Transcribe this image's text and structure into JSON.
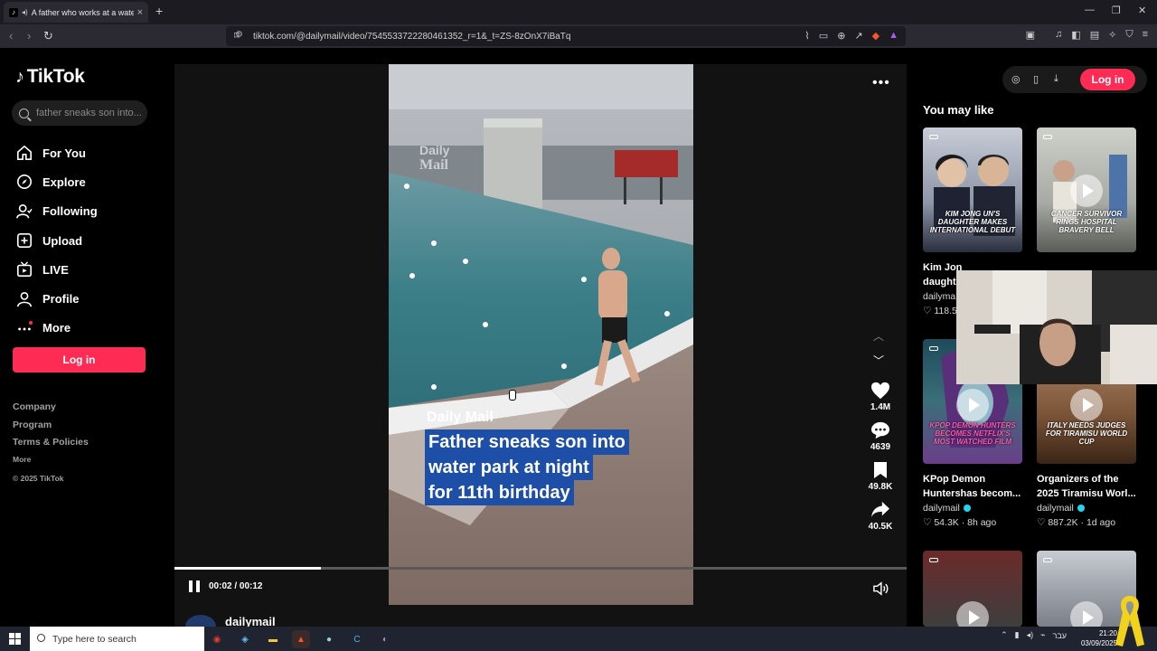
{
  "browser": {
    "tab_title": "A father who works at a wate",
    "url": "tiktok.com/@dailymail/video/7545533722280461352_r=1&_t=ZS-8zOnX7iBaTq",
    "new_tab_symbol": "+"
  },
  "sidebar": {
    "logo": "TikTok",
    "search_placeholder": "father sneaks son into...",
    "nav": [
      {
        "label": "For You",
        "icon": "home-icon"
      },
      {
        "label": "Explore",
        "icon": "compass-icon"
      },
      {
        "label": "Following",
        "icon": "following-icon"
      },
      {
        "label": "Upload",
        "icon": "upload-icon"
      },
      {
        "label": "LIVE",
        "icon": "live-icon"
      },
      {
        "label": "Profile",
        "icon": "profile-icon"
      },
      {
        "label": "More",
        "icon": "more-icon"
      }
    ],
    "login_label": "Log in",
    "footer": {
      "company": "Company",
      "program": "Program",
      "terms": "Terms & Policies",
      "more": "More",
      "copyright": "© 2025 TikTok"
    }
  },
  "player": {
    "caption_lines": [
      "Father sneaks son into",
      "water park at night",
      "for 11th birthday"
    ],
    "watermark": "Daily Mail",
    "time": "00:02 / 00:12",
    "progress": 0.2,
    "likes": "1.4M",
    "comments": "4639",
    "saves": "49.8K",
    "shares": "40.5K",
    "author": "dailymail"
  },
  "right": {
    "login_label": "Log in",
    "heading": "You may like",
    "cards": [
      {
        "caption": "KIM JONG UN'S DAUGHTER MAKES INTERNATIONAL DEBUT",
        "title": "Kim Jon",
        "title2": "daught",
        "author": "dailyma",
        "meta": "118.5",
        "play": false
      },
      {
        "caption": "CANCER SURVIVOR RINGS HOSPITAL BRAVERY BELL",
        "title": "",
        "title2": "",
        "author": "",
        "meta": "",
        "play": true
      },
      {
        "caption": "KPOP DEMON HUNTERS BECOMES NETFLIX'S MOST WATCHED FILM",
        "title": "KPop Demon Huntershas becom...",
        "author": "dailymail",
        "meta": "54.3K · 8h ago",
        "play": true
      },
      {
        "caption": "ITALY NEEDS JUDGES FOR TIRAMISU WORLD CUP",
        "title": "Organizers of the 2025 Tiramisu Worl...",
        "author": "dailymail",
        "meta": "887.2K · 1d ago",
        "play": true
      }
    ]
  },
  "taskbar": {
    "search_placeholder": "Type here to search",
    "time": "21:20",
    "date": "03/09/2025",
    "lang": "עבר"
  }
}
